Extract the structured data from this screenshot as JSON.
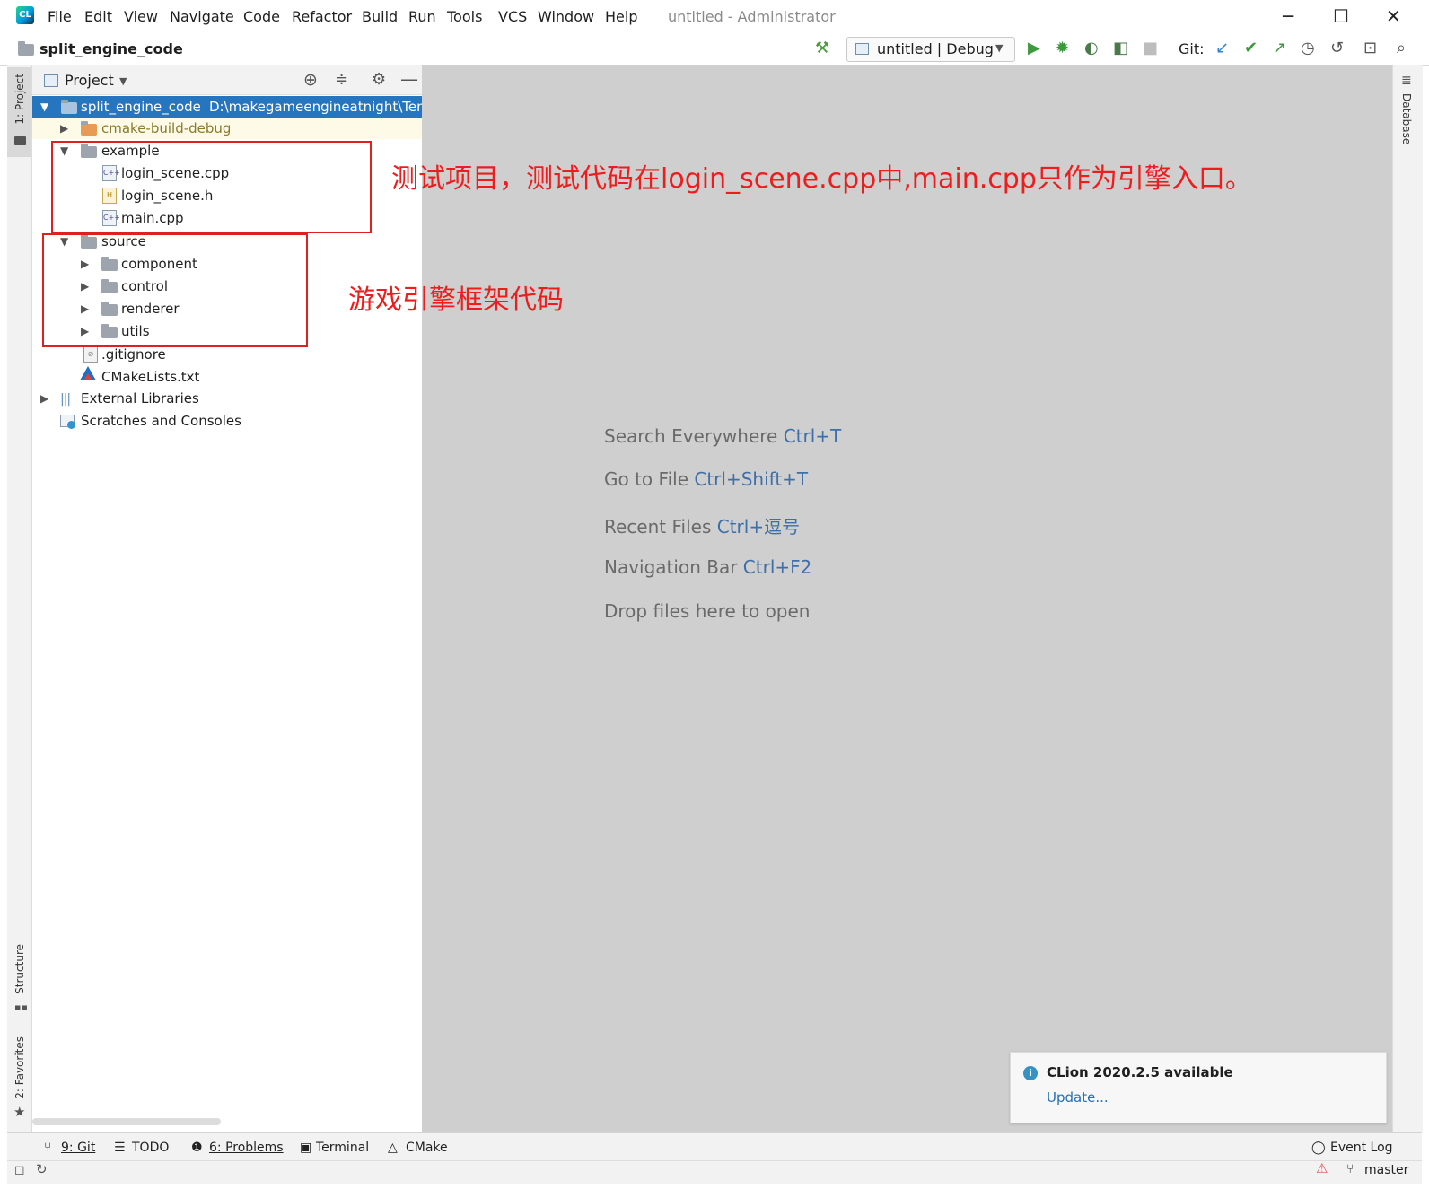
{
  "window": {
    "title": "untitled - Administrator",
    "controls": {
      "minimize": "─",
      "maximize": "☐",
      "close": "✕"
    }
  },
  "menu": [
    "File",
    "Edit",
    "View",
    "Navigate",
    "Code",
    "Refactor",
    "Build",
    "Run",
    "Tools",
    "VCS",
    "Window",
    "Help"
  ],
  "navbar": {
    "breadcrumb": "split_engine_code",
    "run_config": "untitled | Debug",
    "git_label": "Git:"
  },
  "left_stripe": {
    "project_tab": "1: Project",
    "structure_tab": "Structure",
    "favorites_tab": "2: Favorites"
  },
  "right_stripe": {
    "database_tab": "Database"
  },
  "project_panel": {
    "header": "Project",
    "tree": {
      "root_name": "split_engine_code",
      "root_path": "D:\\makegameengineatnight\\Ten",
      "cmake_build": "cmake-build-debug",
      "example": "example",
      "login_scene_cpp": "login_scene.cpp",
      "login_scene_h": "login_scene.h",
      "main_cpp": "main.cpp",
      "source": "source",
      "component": "component",
      "control": "control",
      "renderer": "renderer",
      "utils": "utils",
      "gitignore": ".gitignore",
      "cmakelists": "CMakeLists.txt",
      "external_libraries": "External Libraries",
      "scratches": "Scratches and Consoles"
    }
  },
  "editor_hints": [
    {
      "label": "Search Everywhere",
      "key": "Ctrl+T"
    },
    {
      "label": "Go to File",
      "key": "Ctrl+Shift+T"
    },
    {
      "label": "Recent Files",
      "key": "Ctrl+逗号"
    },
    {
      "label": "Navigation Bar",
      "key": "Ctrl+F2"
    },
    {
      "label": "Drop files here to open",
      "key": ""
    }
  ],
  "annotations": {
    "example_note": "测试项目，测试代码在login_scene.cpp中,main.cpp只作为引擎入口。",
    "source_note": "游戏引擎框架代码"
  },
  "notification": {
    "title": "CLion 2020.2.5 available",
    "link": "Update..."
  },
  "bottom_tools": {
    "git": "9: Git",
    "todo": "TODO",
    "problems": "6: Problems",
    "terminal": "Terminal",
    "cmake": "CMake",
    "event_log": "Event Log"
  },
  "status": {
    "branch": "master"
  },
  "colors": {
    "selection": "#2675bf",
    "annotation_red": "#ee1c1c",
    "editor_bg": "#cfcfcf",
    "hint_key": "#3f6fa8",
    "build_folder": "#8a7a2a"
  }
}
